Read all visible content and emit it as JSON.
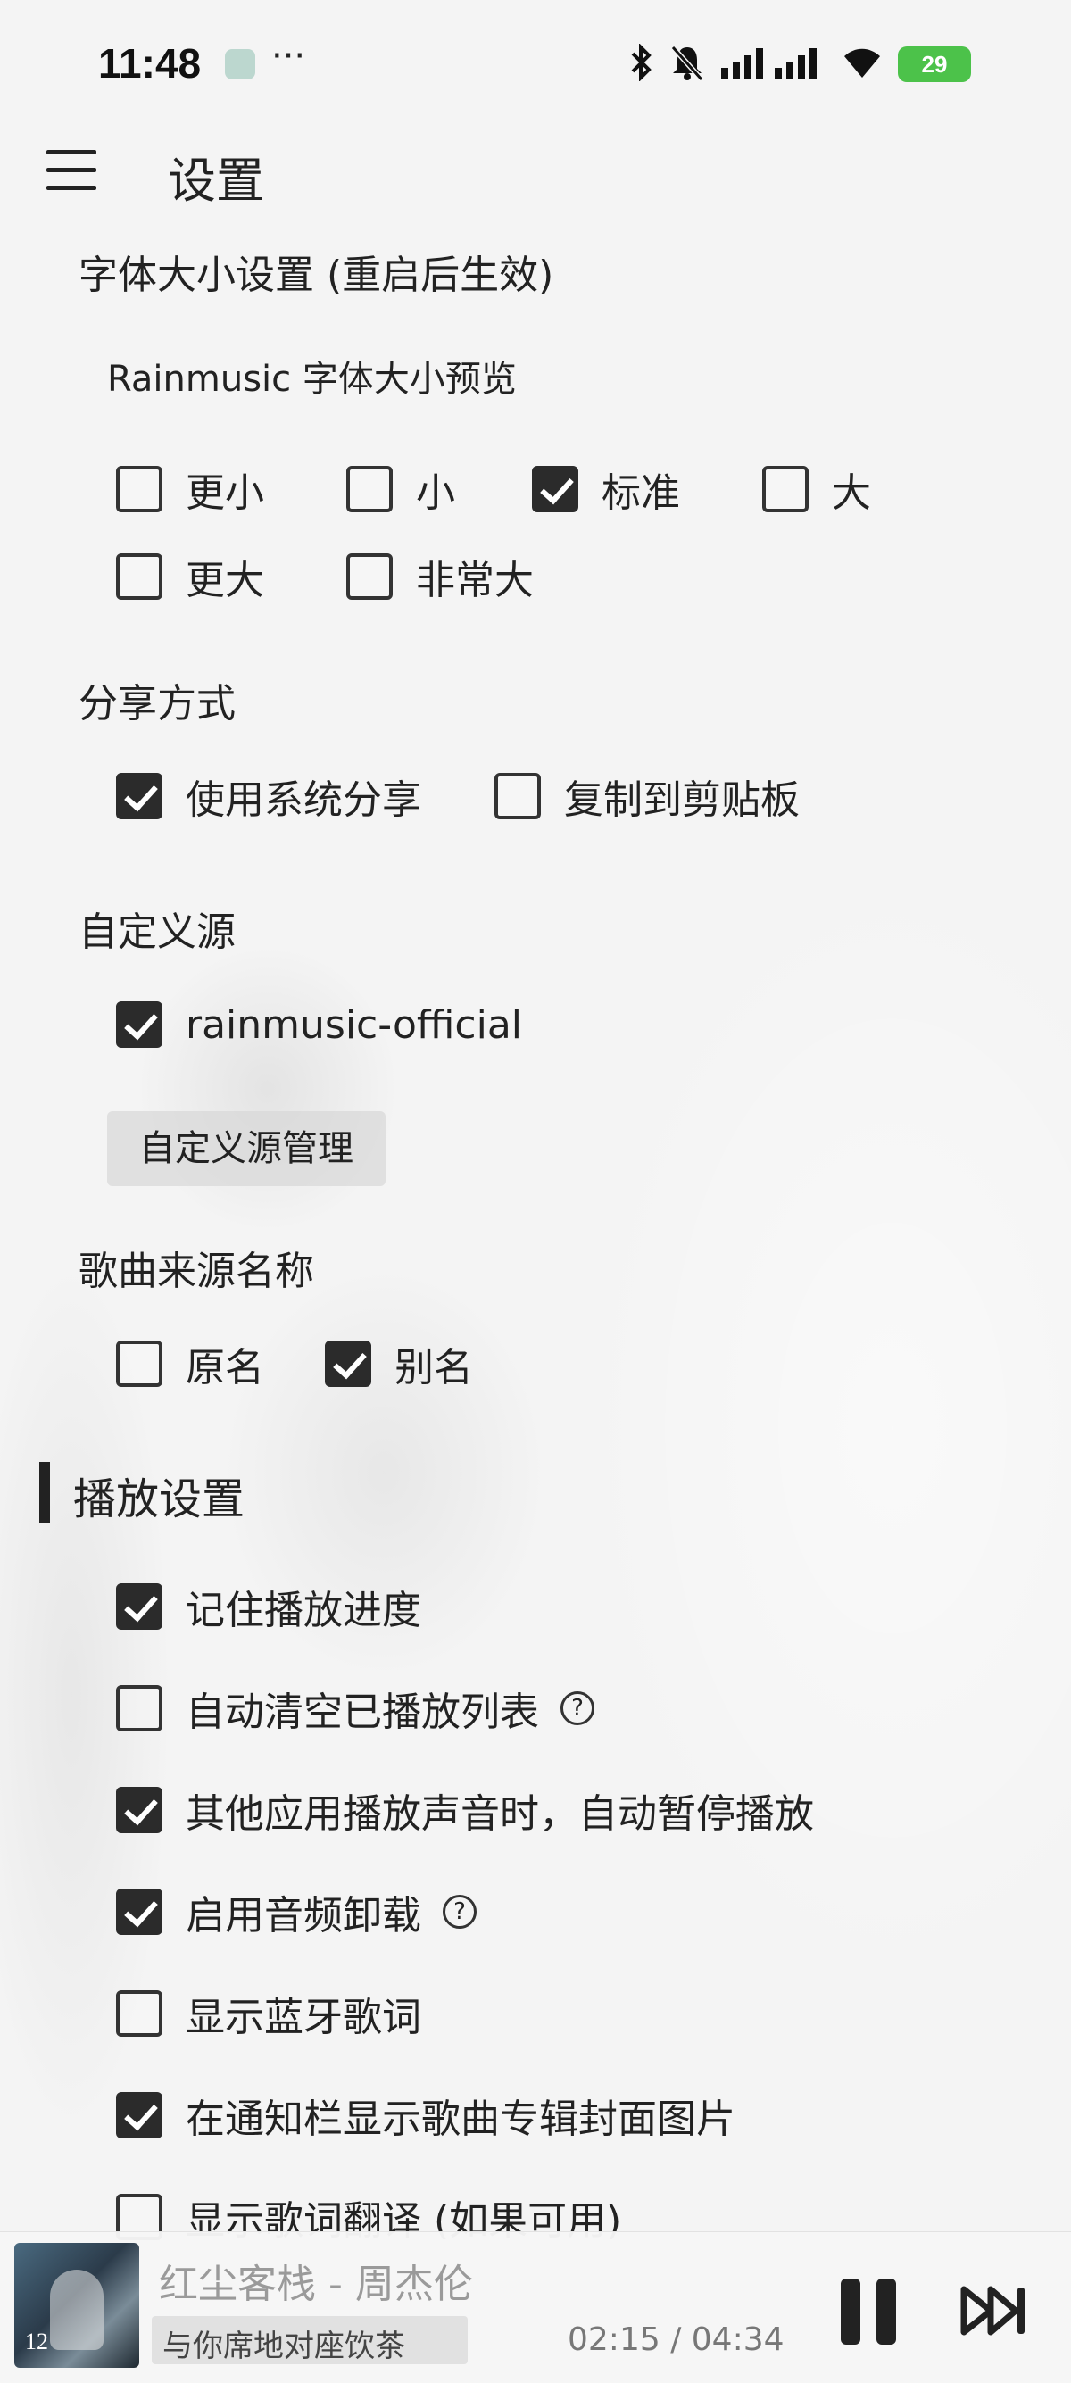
{
  "status": {
    "time": "11:48",
    "dots": "···",
    "battery": "29"
  },
  "appbar": {
    "title": "设置"
  },
  "font_size": {
    "label": "字体大小设置 (重启后生效)",
    "preview": "Rainmusic 字体大小预览",
    "options": [
      {
        "label": "更小",
        "checked": false
      },
      {
        "label": "小",
        "checked": false
      },
      {
        "label": "标准",
        "checked": true
      },
      {
        "label": "大",
        "checked": false
      },
      {
        "label": "更大",
        "checked": false
      },
      {
        "label": "非常大",
        "checked": false
      }
    ]
  },
  "share": {
    "label": "分享方式",
    "options": [
      {
        "label": "使用系统分享",
        "checked": true
      },
      {
        "label": "复制到剪贴板",
        "checked": false
      }
    ]
  },
  "custom_source": {
    "label": "自定义源",
    "options": [
      {
        "label": "rainmusic-official",
        "checked": true
      }
    ],
    "manage_button": "自定义源管理"
  },
  "song_source_name": {
    "label": "歌曲来源名称",
    "options": [
      {
        "label": "原名",
        "checked": false
      },
      {
        "label": "别名",
        "checked": true
      }
    ]
  },
  "playback": {
    "title": "播放设置",
    "options": [
      {
        "label": "记住播放进度",
        "checked": true,
        "help": false
      },
      {
        "label": "自动清空已播放列表",
        "checked": false,
        "help": true
      },
      {
        "label": "其他应用播放声音时，自动暂停播放",
        "checked": true,
        "help": false
      },
      {
        "label": "启用音频卸载",
        "checked": true,
        "help": true
      },
      {
        "label": "显示蓝牙歌词",
        "checked": false,
        "help": false
      },
      {
        "label": "在通知栏显示歌曲专辑封面图片",
        "checked": true,
        "help": false
      },
      {
        "label": "显示歌词翻译 (如果可用)",
        "checked": false,
        "help": false
      }
    ],
    "help_glyph": "?"
  },
  "player": {
    "title": "红尘客栈 - 周杰伦",
    "lyric": "与你席地对座饮茶",
    "time": "02:15 / 04:34",
    "cover_text": "12"
  },
  "colors": {
    "checkbox_on": "#2b2b2b",
    "battery": "#4cc24a"
  }
}
